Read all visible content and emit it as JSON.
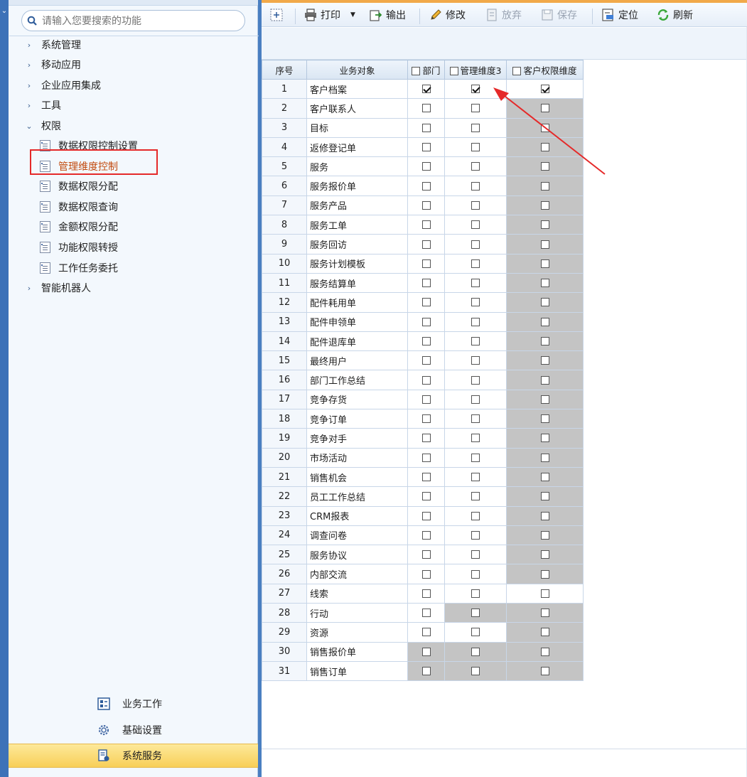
{
  "search": {
    "placeholder": "请输入您要搜索的功能"
  },
  "tree": [
    {
      "label": "系统管理",
      "arrow": "›"
    },
    {
      "label": "移动应用",
      "arrow": "›"
    },
    {
      "label": "企业应用集成",
      "arrow": "›"
    },
    {
      "label": "工具",
      "arrow": "›"
    },
    {
      "label": "权限",
      "arrow": "⌄"
    }
  ],
  "leaves": [
    {
      "label": "数据权限控制设置"
    },
    {
      "label": "管理维度控制"
    },
    {
      "label": "数据权限分配"
    },
    {
      "label": "数据权限查询"
    },
    {
      "label": "金额权限分配"
    },
    {
      "label": "功能权限转授"
    },
    {
      "label": "工作任务委托"
    }
  ],
  "tree_after": {
    "label": "智能机器人",
    "arrow": "›"
  },
  "bottom_nav": [
    {
      "label": "业务工作"
    },
    {
      "label": "基础设置"
    },
    {
      "label": "系统服务"
    }
  ],
  "toolbar": {
    "print": "打印",
    "export": "输出",
    "edit": "修改",
    "discard": "放弃",
    "save": "保存",
    "locate": "定位",
    "refresh": "刷新"
  },
  "table": {
    "headers": [
      "序号",
      "业务对象",
      "部门",
      "管理维度3",
      "客户权限维度"
    ],
    "rows": [
      {
        "no": "1",
        "name": "客户档案",
        "dept": true,
        "dim3": true,
        "cust": true,
        "g": [
          false,
          false,
          false
        ]
      },
      {
        "no": "2",
        "name": "客户联系人",
        "dept": false,
        "dim3": false,
        "cust": false,
        "g": [
          false,
          false,
          true
        ]
      },
      {
        "no": "3",
        "name": "目标",
        "dept": false,
        "dim3": false,
        "cust": false,
        "g": [
          false,
          false,
          true
        ]
      },
      {
        "no": "4",
        "name": "返修登记单",
        "dept": false,
        "dim3": false,
        "cust": false,
        "g": [
          false,
          false,
          true
        ]
      },
      {
        "no": "5",
        "name": "服务",
        "dept": false,
        "dim3": false,
        "cust": false,
        "g": [
          false,
          false,
          true
        ]
      },
      {
        "no": "6",
        "name": "服务报价单",
        "dept": false,
        "dim3": false,
        "cust": false,
        "g": [
          false,
          false,
          true
        ]
      },
      {
        "no": "7",
        "name": "服务产品",
        "dept": false,
        "dim3": false,
        "cust": false,
        "g": [
          false,
          false,
          true
        ]
      },
      {
        "no": "8",
        "name": "服务工单",
        "dept": false,
        "dim3": false,
        "cust": false,
        "g": [
          false,
          false,
          true
        ]
      },
      {
        "no": "9",
        "name": "服务回访",
        "dept": false,
        "dim3": false,
        "cust": false,
        "g": [
          false,
          false,
          true
        ]
      },
      {
        "no": "10",
        "name": "服务计划模板",
        "dept": false,
        "dim3": false,
        "cust": false,
        "g": [
          false,
          false,
          true
        ]
      },
      {
        "no": "11",
        "name": "服务结算单",
        "dept": false,
        "dim3": false,
        "cust": false,
        "g": [
          false,
          false,
          true
        ]
      },
      {
        "no": "12",
        "name": "配件耗用单",
        "dept": false,
        "dim3": false,
        "cust": false,
        "g": [
          false,
          false,
          true
        ]
      },
      {
        "no": "13",
        "name": "配件申领单",
        "dept": false,
        "dim3": false,
        "cust": false,
        "g": [
          false,
          false,
          true
        ]
      },
      {
        "no": "14",
        "name": "配件退库单",
        "dept": false,
        "dim3": false,
        "cust": false,
        "g": [
          false,
          false,
          true
        ]
      },
      {
        "no": "15",
        "name": "最终用户",
        "dept": false,
        "dim3": false,
        "cust": false,
        "g": [
          false,
          false,
          true
        ]
      },
      {
        "no": "16",
        "name": "部门工作总结",
        "dept": false,
        "dim3": false,
        "cust": false,
        "g": [
          false,
          false,
          true
        ]
      },
      {
        "no": "17",
        "name": "竞争存货",
        "dept": false,
        "dim3": false,
        "cust": false,
        "g": [
          false,
          false,
          true
        ]
      },
      {
        "no": "18",
        "name": "竞争订单",
        "dept": false,
        "dim3": false,
        "cust": false,
        "g": [
          false,
          false,
          true
        ]
      },
      {
        "no": "19",
        "name": "竞争对手",
        "dept": false,
        "dim3": false,
        "cust": false,
        "g": [
          false,
          false,
          true
        ]
      },
      {
        "no": "20",
        "name": "市场活动",
        "dept": false,
        "dim3": false,
        "cust": false,
        "g": [
          false,
          false,
          true
        ]
      },
      {
        "no": "21",
        "name": "销售机会",
        "dept": false,
        "dim3": false,
        "cust": false,
        "g": [
          false,
          false,
          true
        ]
      },
      {
        "no": "22",
        "name": "员工工作总结",
        "dept": false,
        "dim3": false,
        "cust": false,
        "g": [
          false,
          false,
          true
        ]
      },
      {
        "no": "23",
        "name": "CRM报表",
        "dept": false,
        "dim3": false,
        "cust": false,
        "g": [
          false,
          false,
          true
        ]
      },
      {
        "no": "24",
        "name": "调查问卷",
        "dept": false,
        "dim3": false,
        "cust": false,
        "g": [
          false,
          false,
          true
        ]
      },
      {
        "no": "25",
        "name": "服务协议",
        "dept": false,
        "dim3": false,
        "cust": false,
        "g": [
          false,
          false,
          true
        ]
      },
      {
        "no": "26",
        "name": "内部交流",
        "dept": false,
        "dim3": false,
        "cust": false,
        "g": [
          false,
          false,
          true
        ]
      },
      {
        "no": "27",
        "name": "线索",
        "dept": false,
        "dim3": false,
        "cust": false,
        "g": [
          false,
          false,
          false
        ]
      },
      {
        "no": "28",
        "name": "行动",
        "dept": false,
        "dim3": false,
        "cust": false,
        "g": [
          false,
          true,
          true
        ]
      },
      {
        "no": "29",
        "name": "资源",
        "dept": false,
        "dim3": false,
        "cust": false,
        "g": [
          false,
          false,
          true
        ]
      },
      {
        "no": "30",
        "name": "销售报价单",
        "dept": false,
        "dim3": false,
        "cust": false,
        "g": [
          true,
          true,
          true
        ]
      },
      {
        "no": "31",
        "name": "销售订单",
        "dept": false,
        "dim3": false,
        "cust": false,
        "g": [
          true,
          true,
          true
        ]
      }
    ]
  },
  "colors": {
    "accent": "#e52929",
    "active_text": "#c24b0f",
    "disabled_cell": "#c4c4c4"
  }
}
